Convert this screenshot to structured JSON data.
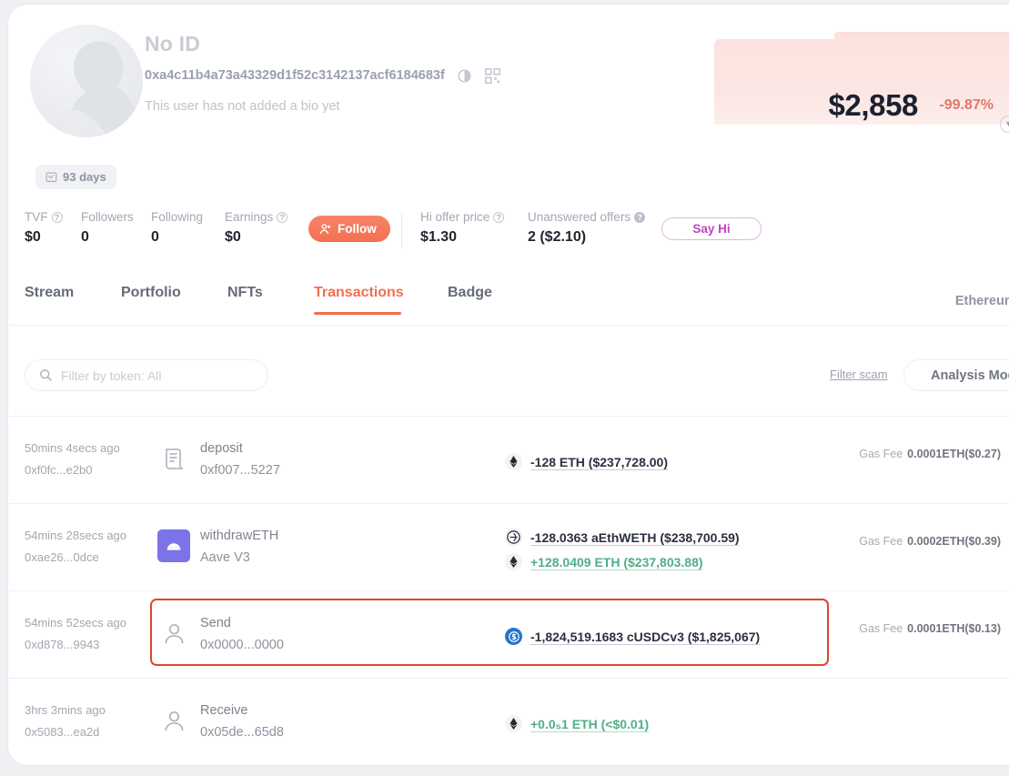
{
  "profile": {
    "name": "No ID",
    "address": "0xa4c11b4a73a43329d1f52c3142137acf6184683f",
    "bio": "This user has not added a bio yet",
    "days_badge": "93 days",
    "copy_icon": "copy-icon",
    "qr_icon": "qr-code-icon",
    "avatar_icon": "default-avatar"
  },
  "balance": {
    "amount": "$2,858",
    "change": "-99.87%",
    "change_color": "#e0786b",
    "expand_icon": "chevron-down-icon"
  },
  "stats": [
    {
      "label": "TVF",
      "value": "$0",
      "has_tooltip": true,
      "tooltip_style": "outline"
    },
    {
      "label": "Followers",
      "value": "0",
      "has_tooltip": false
    },
    {
      "label": "Following",
      "value": "0",
      "has_tooltip": false
    },
    {
      "label": "Earnings",
      "value": "$0",
      "has_tooltip": true,
      "tooltip_style": "outline"
    },
    {
      "label": "Hi offer price",
      "value": "$1.30",
      "has_tooltip": true,
      "tooltip_style": "outline"
    },
    {
      "label": "Unanswered offers",
      "value": "2 ($2.10)",
      "has_tooltip": true,
      "tooltip_style": "filled"
    }
  ],
  "actions": {
    "follow_label": "Follow",
    "follow_icon": "person-add-icon",
    "follow_color": "#f4764f",
    "sayhi_label": "Say Hi",
    "sayhi_color": "#c344c0"
  },
  "tabs": [
    {
      "label": "Stream",
      "active": false
    },
    {
      "label": "Portfolio",
      "active": false
    },
    {
      "label": "NFTs",
      "active": false
    },
    {
      "label": "Transactions",
      "active": true
    },
    {
      "label": "Badge",
      "active": false
    }
  ],
  "chain_selector": {
    "label": "Ethereum",
    "icon": "chevron-down-icon"
  },
  "toolbar": {
    "search_placeholder": "Filter by token: All",
    "search_value": "",
    "search_icon": "search-icon",
    "filter_scam_label": "Filter scam",
    "analysis_mode_label": "Analysis Mode"
  },
  "transactions": [
    {
      "time": "50mins 4secs ago",
      "hash": "0xf0fc...e2b0",
      "icon": "contract-document-icon",
      "method": "deposit",
      "counterparty": "0xf007...5227",
      "assets": [
        {
          "token_icon": "eth-icon",
          "text": "-128 ETH ($237,728.00)",
          "direction": "out"
        }
      ],
      "gas_label": "Gas Fee",
      "gas_value": "0.0001ETH($0.27)",
      "highlighted": false
    },
    {
      "time": "54mins 28secs ago",
      "hash": "0xae26...0dce",
      "icon": "aave-icon",
      "method": "withdrawETH",
      "counterparty": "Aave V3",
      "assets": [
        {
          "token_icon": "aethweth-icon",
          "text": "-128.0363 aEthWETH ($238,700.59)",
          "direction": "out"
        },
        {
          "token_icon": "eth-icon",
          "text": "+128.0409 ETH ($237,803.88)",
          "direction": "in"
        }
      ],
      "gas_label": "Gas Fee",
      "gas_value": "0.0002ETH($0.39)",
      "highlighted": false
    },
    {
      "time": "54mins 52secs ago",
      "hash": "0xd878...9943",
      "icon": "person-icon",
      "method": "Send",
      "counterparty": "0x0000...0000",
      "assets": [
        {
          "token_icon": "usdc-icon",
          "text": "-1,824,519.1683 cUSDCv3 ($1,825,067)",
          "direction": "out"
        }
      ],
      "gas_label": "Gas Fee",
      "gas_value": "0.0001ETH($0.13)",
      "highlighted": true
    },
    {
      "time": "3hrs 3mins ago",
      "hash": "0x5083...ea2d",
      "icon": "person-icon",
      "method": "Receive",
      "counterparty": "0x05de...65d8",
      "assets": [
        {
          "token_icon": "eth-icon",
          "text": "+0.0₅1 ETH (<$0.01)",
          "direction": "in"
        }
      ],
      "gas_label": "",
      "gas_value": "",
      "highlighted": false
    }
  ]
}
